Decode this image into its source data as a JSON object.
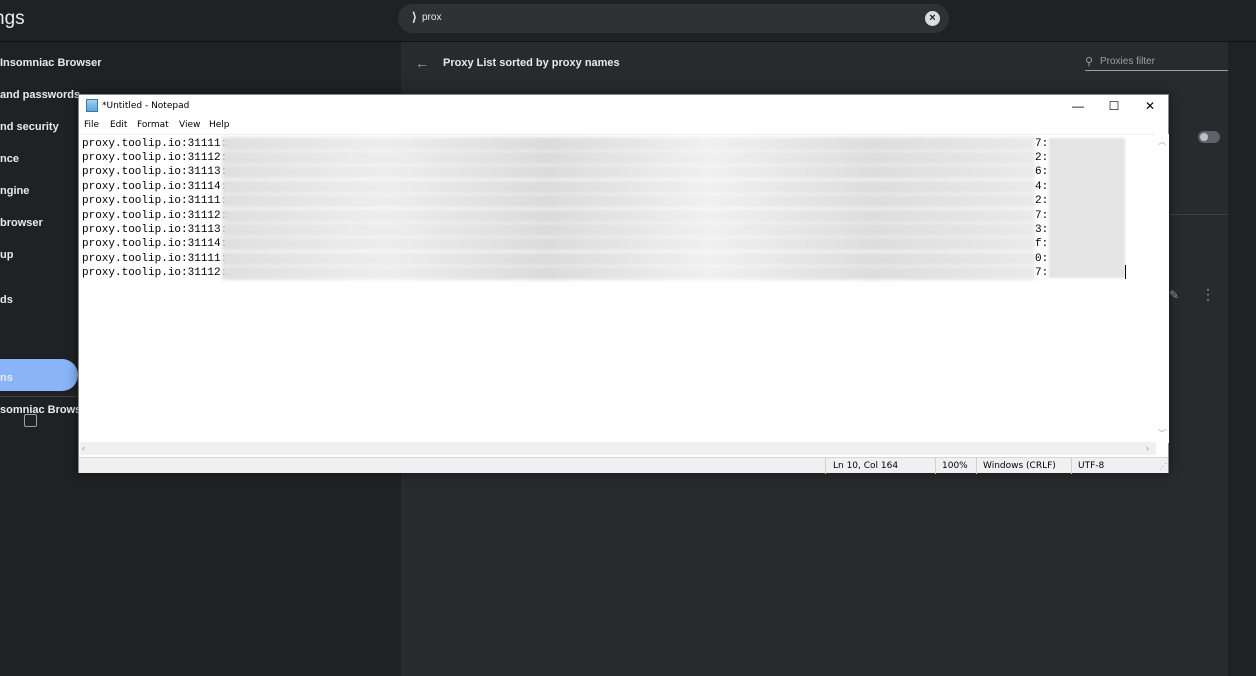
{
  "browser": {
    "header_title": "ngs",
    "search": {
      "icon": "search-icon",
      "value": "prox"
    },
    "sidebar": {
      "items": [
        "Insomniac Browser",
        "and passwords",
        "nd security",
        "nce",
        "ngine",
        "browser",
        "up",
        "ds",
        "ns",
        "somniac Brows"
      ]
    },
    "panel": {
      "title": "Proxy List sorted by proxy names",
      "filter_placeholder": "Proxies filter"
    }
  },
  "notepad": {
    "title": "*Untitled - Notepad",
    "menu": [
      "File",
      "Edit",
      "Format",
      "View",
      "Help"
    ],
    "lines": [
      {
        "prefix": "proxy.toolip.io:31111:",
        "tail": "7:"
      },
      {
        "prefix": "proxy.toolip.io:31112:",
        "tail": "2:"
      },
      {
        "prefix": "proxy.toolip.io:31113:",
        "tail": "6:"
      },
      {
        "prefix": "proxy.toolip.io:31114:",
        "tail": "4:"
      },
      {
        "prefix": "proxy.toolip.io:31111:",
        "tail": "2:"
      },
      {
        "prefix": "proxy.toolip.io:31112:",
        "tail": "7:"
      },
      {
        "prefix": "proxy.toolip.io:31113:",
        "tail": "3:"
      },
      {
        "prefix": "proxy.toolip.io:31114:",
        "tail": "f:"
      },
      {
        "prefix": "proxy.toolip.io:31111:",
        "tail": "0:"
      },
      {
        "prefix": "proxy.toolip.io:31112:",
        "tail": "7:"
      }
    ],
    "status": {
      "position": "Ln 10, Col 164",
      "zoom": "100%",
      "line_ending": "Windows (CRLF)",
      "encoding": "UTF-8"
    }
  }
}
